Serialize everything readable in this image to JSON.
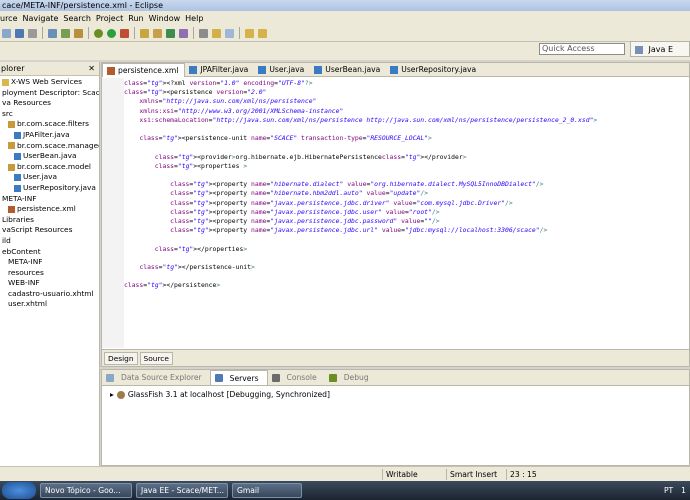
{
  "window": {
    "title": "cace/META-INF/persistence.xml - Eclipse"
  },
  "menu": [
    "urce",
    "Navigate",
    "Search",
    "Project",
    "Run",
    "Window",
    "Help"
  ],
  "quick_access": {
    "placeholder": "Quick Access"
  },
  "perspective": {
    "label": "Java E"
  },
  "explorer": {
    "title": "plorer",
    "items": [
      {
        "label": "X-WS Web Services",
        "icon": "folder-icon",
        "depth": 0
      },
      {
        "label": "ployment Descriptor: Scace",
        "icon": "none",
        "depth": 0
      },
      {
        "label": "va Resources",
        "icon": "none",
        "depth": 0
      },
      {
        "label": "src",
        "icon": "none",
        "depth": 0
      },
      {
        "label": "br.com.scace.filters",
        "icon": "package-icon",
        "depth": 1
      },
      {
        "label": "JPAFilter.java",
        "icon": "java-file-icon",
        "depth": 2
      },
      {
        "label": "br.com.scace.managed",
        "icon": "package-icon",
        "depth": 1
      },
      {
        "label": "UserBean.java",
        "icon": "java-file-icon",
        "depth": 2
      },
      {
        "label": "br.com.scace.model",
        "icon": "package-icon",
        "depth": 1
      },
      {
        "label": "User.java",
        "icon": "java-file-icon",
        "depth": 2
      },
      {
        "label": "UserRepository.java",
        "icon": "java-file-icon",
        "depth": 2
      },
      {
        "label": "META-INF",
        "icon": "none",
        "depth": 0
      },
      {
        "label": "persistence.xml",
        "icon": "xml-file-icon",
        "depth": 1
      },
      {
        "label": "Libraries",
        "icon": "none",
        "depth": 0
      },
      {
        "label": "vaScript Resources",
        "icon": "none",
        "depth": 0
      },
      {
        "label": "ild",
        "icon": "none",
        "depth": 0
      },
      {
        "label": "ebContent",
        "icon": "none",
        "depth": 0
      },
      {
        "label": "META-INF",
        "icon": "none",
        "depth": 1
      },
      {
        "label": "resources",
        "icon": "none",
        "depth": 1
      },
      {
        "label": "WEB-INF",
        "icon": "none",
        "depth": 1
      },
      {
        "label": "cadastro-usuario.xhtml",
        "icon": "none",
        "depth": 1
      },
      {
        "label": "user.xhtml",
        "icon": "none",
        "depth": 1
      }
    ]
  },
  "editor": {
    "tabs": [
      {
        "label": "persistence.xml",
        "active": true,
        "icon": "xml-file-icon"
      },
      {
        "label": "JPAFilter.java",
        "active": false,
        "icon": "java-file-icon"
      },
      {
        "label": "User.java",
        "active": false,
        "icon": "java-file-icon"
      },
      {
        "label": "UserBean.java",
        "active": false,
        "icon": "java-file-icon"
      },
      {
        "label": "UserRepository.java",
        "active": false,
        "icon": "java-file-icon"
      }
    ],
    "lines": [
      "<?xml version=\"1.0\" encoding=\"UTF-8\"?>",
      "<persistence version=\"2.0\"",
      "    xmlns=\"http://java.sun.com/xml/ns/persistence\"",
      "    xmlns:xsi=\"http://www.w3.org/2001/XMLSchema-instance\"",
      "    xsi:schemaLocation=\"http://java.sun.com/xml/ns/persistence http://java.sun.com/xml/ns/persistence/persistence_2_0.xsd\">",
      "",
      "    <persistence-unit name=\"SCACE\" transaction-type=\"RESOURCE_LOCAL\">",
      "",
      "        <provider>org.hibernate.ejb.HibernatePersistence</provider>",
      "        <properties >",
      "",
      "            <property name=\"hibernate.dialect\" value=\"org.hibernate.dialect.MySQL5InnoDBDialect\"/>",
      "            <property name=\"hibernate.hbm2ddl.auto\" value=\"update\"/>",
      "            <property name=\"javax.persistence.jdbc.driver\" value=\"com.mysql.jdbc.Driver\"/>",
      "            <property name=\"javax.persistence.jdbc.user\" value=\"root\"/>",
      "            <property name=\"javax.persistence.jdbc.password\" value=\"\"/>",
      "            <property name=\"javax.persistence.jdbc.url\" value=\"jdbc:mysql://localhost:3306/scace\"/>",
      "",
      "        </properties>",
      "",
      "    </persistence-unit>",
      "",
      "</persistence>"
    ],
    "bottom_tabs": [
      "Design",
      "Source"
    ]
  },
  "servers_panel": {
    "tabs": [
      "Data Source Explorer",
      "Servers",
      "Console",
      "Debug"
    ],
    "active_tab": "Servers",
    "entries": [
      "GlassFish 3.1 at localhost  [Debugging, Synchronized]"
    ]
  },
  "status": {
    "mode": "Writable",
    "insert": "Smart Insert",
    "position": "23 : 15"
  },
  "taskbar": {
    "items": [
      "Novo Tópico - Goo...",
      "Java EE - Scace/MET...",
      "Gmail"
    ],
    "lang": "PT",
    "clock": "1"
  },
  "colors": {
    "tag": "#3f7f7f",
    "attr_name": "#7f007f",
    "attr_value": "#2a00ff"
  }
}
